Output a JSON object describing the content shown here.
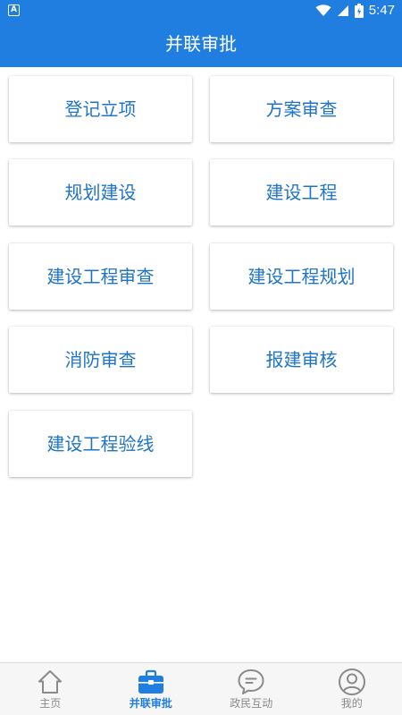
{
  "status_bar": {
    "notification_badge": "A",
    "time": "5:47",
    "icons": [
      "wifi-icon",
      "signal-icon",
      "battery-icon"
    ]
  },
  "app_bar": {
    "title": "并联审批"
  },
  "cards": [
    {
      "label": "登记立项"
    },
    {
      "label": "方案审查"
    },
    {
      "label": "规划建设"
    },
    {
      "label": "建设工程"
    },
    {
      "label": "建设工程审查"
    },
    {
      "label": "建设工程规划"
    },
    {
      "label": "消防审查"
    },
    {
      "label": "报建审核"
    },
    {
      "label": "建设工程验线"
    }
  ],
  "bottom_nav": {
    "items": [
      {
        "label": "主页",
        "icon": "home-icon",
        "active": false
      },
      {
        "label": "并联审批",
        "icon": "briefcase-icon",
        "active": true
      },
      {
        "label": "政民互动",
        "icon": "chat-bubble-icon",
        "active": false
      },
      {
        "label": "我的",
        "icon": "user-icon",
        "active": false
      }
    ]
  },
  "colors": {
    "primary": "#1f7ee0",
    "card_text": "#1f74c8",
    "nav_inactive": "#8a8a8a"
  }
}
